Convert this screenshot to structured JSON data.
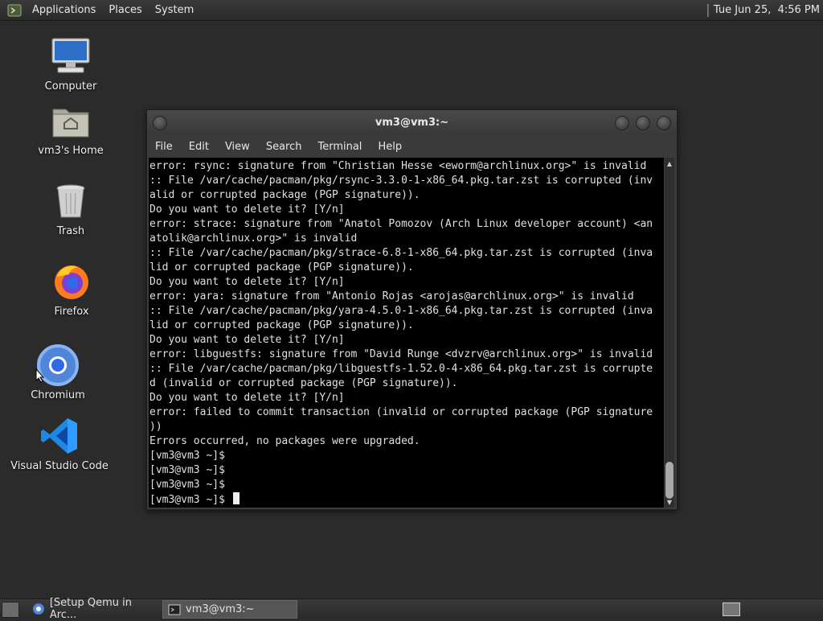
{
  "top_panel": {
    "menus": [
      "Applications",
      "Places",
      "System"
    ],
    "clock": "Tue Jun 25,  4:56 PM"
  },
  "desktop": {
    "icons": [
      {
        "label": "Computer",
        "icon": "computer-icon"
      },
      {
        "label": "vm3's Home",
        "icon": "home-folder-icon"
      },
      {
        "label": "Trash",
        "icon": "trash-icon"
      },
      {
        "label": "Firefox",
        "icon": "firefox-icon"
      },
      {
        "label": "Chromium",
        "icon": "chromium-icon"
      },
      {
        "label": "Visual Studio Code",
        "icon": "vscode-icon"
      }
    ]
  },
  "terminal": {
    "title": "vm3@vm3:~",
    "menu": [
      "File",
      "Edit",
      "View",
      "Search",
      "Terminal",
      "Help"
    ],
    "lines": [
      "error: rsync: signature from \"Christian Hesse <eworm@archlinux.org>\" is invalid",
      ":: File /var/cache/pacman/pkg/rsync-3.3.0-1-x86_64.pkg.tar.zst is corrupted (inv",
      "alid or corrupted package (PGP signature)).",
      "Do you want to delete it? [Y/n]",
      "error: strace: signature from \"Anatol Pomozov (Arch Linux developer account) <an",
      "atolik@archlinux.org>\" is invalid",
      ":: File /var/cache/pacman/pkg/strace-6.8-1-x86_64.pkg.tar.zst is corrupted (inva",
      "lid or corrupted package (PGP signature)).",
      "Do you want to delete it? [Y/n]",
      "error: yara: signature from \"Antonio Rojas <arojas@archlinux.org>\" is invalid",
      ":: File /var/cache/pacman/pkg/yara-4.5.0-1-x86_64.pkg.tar.zst is corrupted (inva",
      "lid or corrupted package (PGP signature)).",
      "Do you want to delete it? [Y/n]",
      "error: libguestfs: signature from \"David Runge <dvzrv@archlinux.org>\" is invalid",
      ":: File /var/cache/pacman/pkg/libguestfs-1.52.0-4-x86_64.pkg.tar.zst is corrupte",
      "d (invalid or corrupted package (PGP signature)).",
      "Do you want to delete it? [Y/n]",
      "error: failed to commit transaction (invalid or corrupted package (PGP signature",
      "))",
      "Errors occurred, no packages were upgraded.",
      "[vm3@vm3 ~]$",
      "[vm3@vm3 ~]$",
      "[vm3@vm3 ~]$",
      "[vm3@vm3 ~]$ "
    ]
  },
  "taskbar": {
    "tasks": [
      {
        "label": "[Setup Qemu in Arc...",
        "icon": "browser-icon",
        "active": false
      },
      {
        "label": "vm3@vm3:~",
        "icon": "terminal-icon",
        "active": true
      }
    ]
  }
}
